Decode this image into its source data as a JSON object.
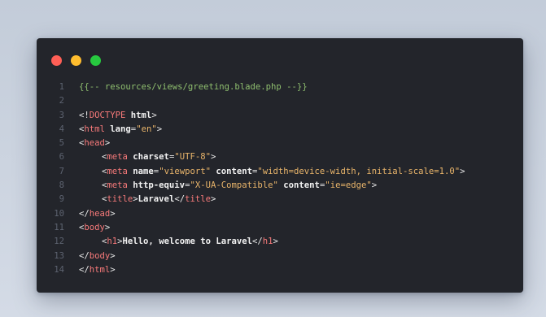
{
  "window": {
    "controls": [
      {
        "name": "close",
        "color": "#ff5f56"
      },
      {
        "name": "minimize",
        "color": "#ffbd2e"
      },
      {
        "name": "maximize",
        "color": "#27c93f"
      }
    ]
  },
  "code": {
    "lines": [
      {
        "n": "1",
        "indent": 0,
        "tokens": [
          {
            "t": "comment",
            "v": "{{-- resources/views/greeting.blade.php --}}"
          }
        ]
      },
      {
        "n": "2",
        "indent": 0,
        "tokens": []
      },
      {
        "n": "3",
        "indent": 0,
        "tokens": [
          {
            "t": "punct",
            "v": "<!"
          },
          {
            "t": "tag",
            "v": "DOCTYPE"
          },
          {
            "t": "attr",
            "v": " html"
          },
          {
            "t": "punct",
            "v": ">"
          }
        ]
      },
      {
        "n": "4",
        "indent": 0,
        "tokens": [
          {
            "t": "punct",
            "v": "<"
          },
          {
            "t": "tag",
            "v": "html"
          },
          {
            "t": "attr",
            "v": " lang"
          },
          {
            "t": "punct",
            "v": "="
          },
          {
            "t": "str",
            "v": "\"en\""
          },
          {
            "t": "punct",
            "v": ">"
          }
        ]
      },
      {
        "n": "5",
        "indent": 0,
        "tokens": [
          {
            "t": "punct",
            "v": "<"
          },
          {
            "t": "tag",
            "v": "head"
          },
          {
            "t": "punct",
            "v": ">"
          }
        ]
      },
      {
        "n": "6",
        "indent": 1,
        "tokens": [
          {
            "t": "punct",
            "v": "<"
          },
          {
            "t": "tag",
            "v": "meta"
          },
          {
            "t": "attr",
            "v": " charset"
          },
          {
            "t": "punct",
            "v": "="
          },
          {
            "t": "str",
            "v": "\"UTF-8\""
          },
          {
            "t": "punct",
            "v": ">"
          }
        ]
      },
      {
        "n": "7",
        "indent": 1,
        "tokens": [
          {
            "t": "punct",
            "v": "<"
          },
          {
            "t": "tag",
            "v": "meta"
          },
          {
            "t": "attr",
            "v": " name"
          },
          {
            "t": "punct",
            "v": "="
          },
          {
            "t": "str",
            "v": "\"viewport\""
          },
          {
            "t": "attr",
            "v": " content"
          },
          {
            "t": "punct",
            "v": "="
          },
          {
            "t": "str",
            "v": "\"width=device-width, initial-scale=1.0\""
          },
          {
            "t": "punct",
            "v": ">"
          }
        ]
      },
      {
        "n": "8",
        "indent": 1,
        "tokens": [
          {
            "t": "punct",
            "v": "<"
          },
          {
            "t": "tag",
            "v": "meta"
          },
          {
            "t": "attr",
            "v": " http-equiv"
          },
          {
            "t": "punct",
            "v": "="
          },
          {
            "t": "str",
            "v": "\"X-UA-Compatible\""
          },
          {
            "t": "attr",
            "v": " content"
          },
          {
            "t": "punct",
            "v": "="
          },
          {
            "t": "str",
            "v": "\"ie=edge\""
          },
          {
            "t": "punct",
            "v": ">"
          }
        ]
      },
      {
        "n": "9",
        "indent": 1,
        "tokens": [
          {
            "t": "punct",
            "v": "<"
          },
          {
            "t": "tag",
            "v": "title"
          },
          {
            "t": "punct",
            "v": ">"
          },
          {
            "t": "text",
            "v": "Laravel"
          },
          {
            "t": "punct",
            "v": "</"
          },
          {
            "t": "tag",
            "v": "title"
          },
          {
            "t": "punct",
            "v": ">"
          }
        ]
      },
      {
        "n": "10",
        "indent": 0,
        "tokens": [
          {
            "t": "punct",
            "v": "</"
          },
          {
            "t": "tag",
            "v": "head"
          },
          {
            "t": "punct",
            "v": ">"
          }
        ]
      },
      {
        "n": "11",
        "indent": 0,
        "tokens": [
          {
            "t": "punct",
            "v": "<"
          },
          {
            "t": "tag",
            "v": "body"
          },
          {
            "t": "punct",
            "v": ">"
          }
        ]
      },
      {
        "n": "12",
        "indent": 1,
        "tokens": [
          {
            "t": "punct",
            "v": "<"
          },
          {
            "t": "tag",
            "v": "h1"
          },
          {
            "t": "punct",
            "v": ">"
          },
          {
            "t": "text",
            "v": "Hello, welcome to Laravel"
          },
          {
            "t": "punct",
            "v": "</"
          },
          {
            "t": "tag",
            "v": "h1"
          },
          {
            "t": "punct",
            "v": ">"
          }
        ]
      },
      {
        "n": "13",
        "indent": 0,
        "tokens": [
          {
            "t": "punct",
            "v": "</"
          },
          {
            "t": "tag",
            "v": "body"
          },
          {
            "t": "punct",
            "v": ">"
          }
        ]
      },
      {
        "n": "14",
        "indent": 0,
        "tokens": [
          {
            "t": "punct",
            "v": "</"
          },
          {
            "t": "tag",
            "v": "html"
          },
          {
            "t": "punct",
            "v": ">"
          }
        ]
      }
    ]
  }
}
